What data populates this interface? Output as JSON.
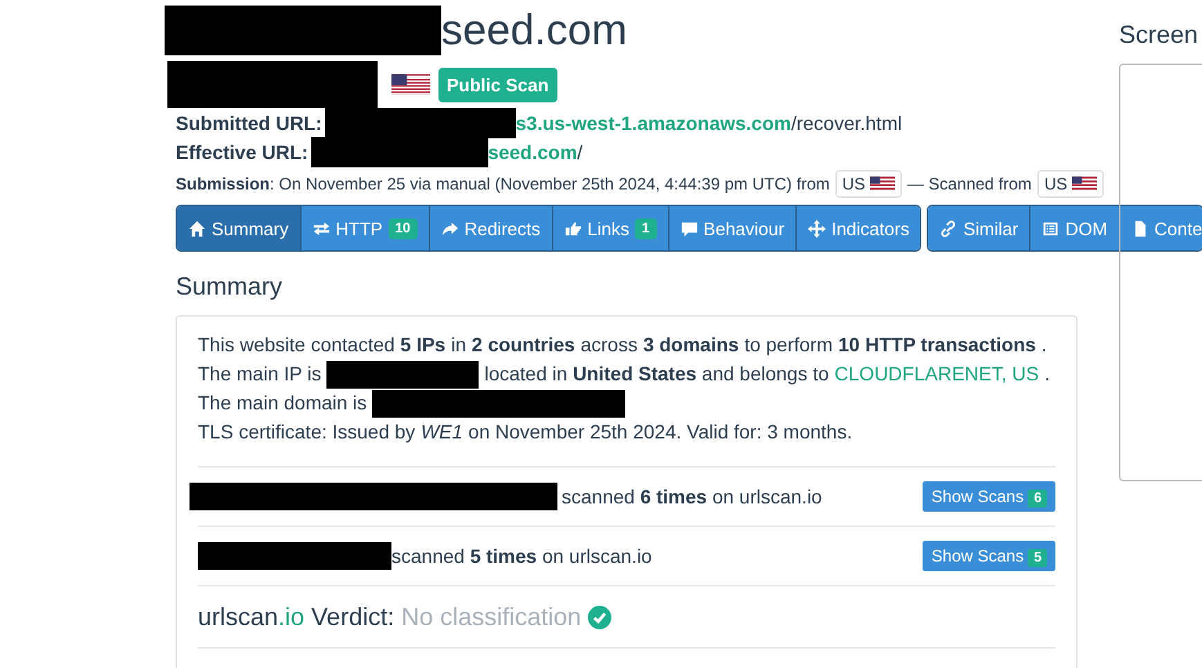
{
  "title": {
    "text": "seed.com"
  },
  "scan_badge": "Public Scan",
  "submitted_url": {
    "label": "Submitted URL:",
    "link": "s3.us-west-1.amazonaws.com",
    "rest": "/recover.html"
  },
  "effective_url": {
    "label": "Effective URL:",
    "link": "seed.com",
    "rest": "/"
  },
  "submission": {
    "text": "**Submission**: On November 25 via manual (November 25th 2024, 4:44:39 pm UTC) from",
    "from_country": "US",
    "scanned_label": "— Scanned from",
    "scanned_country": "US"
  },
  "tab_groups": [
    [
      {
        "label": "Summary",
        "selected": true
      },
      {
        "label": "HTTP",
        "count": "10",
        "selected": false
      },
      {
        "label": "Redirects",
        "selected": false
      },
      {
        "label": "Links",
        "count": "1",
        "selected": false
      },
      {
        "label": "Behaviour",
        "selected": false
      },
      {
        "label": "Indicators",
        "selected": false
      }
    ],
    [
      {
        "label": "Similar",
        "selected": false
      },
      {
        "label": "DOM",
        "selected": false
      },
      {
        "label": "Conte",
        "selected": false
      }
    ]
  ],
  "summary": {
    "heading": "Summary",
    "line_1": "This website contacted **5 IPs** in **2 countries** across **3 domains** to perform **10 HTTP transactions**.",
    "line_2_start": "The main IP is",
    "line_2_middle": "located in **United States** and belongs to",
    "line_2_link": "CLOUDFLARENET, US",
    "line_2_end": ".",
    "line_3": "The main domain is",
    "line_4": "TLS certificate: Issued by *WE1* on November 25th 2024. Valid for: 3 months.",
    "scans": [
      {
        "text": "scanned **6 times** on urlscan.io",
        "button": "Show Scans",
        "count": "6"
      },
      {
        "text": "scanned **5 times** on urlscan.io",
        "button": "Show Scans",
        "count": "5"
      }
    ],
    "verdict": {
      "brand": "urlscan",
      "brand_suffix": ".io",
      "label": "Verdict:",
      "value": "No classification"
    }
  },
  "screenshot": {
    "heading": "Screen"
  }
}
